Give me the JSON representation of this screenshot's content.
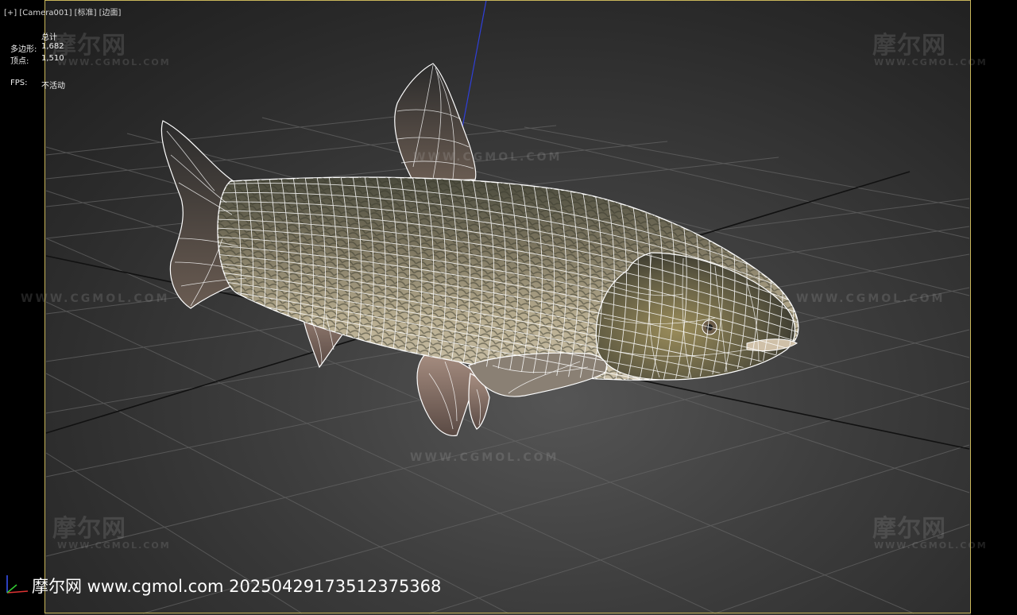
{
  "viewport": {
    "label": "[+] [Camera001] [标准] [边面]"
  },
  "stats": {
    "total_label": "总计",
    "polygons_label": "多边形:",
    "polygons_value": "1,682",
    "vertices_label": "顶点:",
    "vertices_value": "1,510",
    "fps_label": "FPS:",
    "fps_value": "不活动"
  },
  "watermark": {
    "logo": "摩尔网",
    "url_small": "WWW.CGMOL.COM",
    "url": "WWW.CGMOL.COM"
  },
  "footer": {
    "text": "摩尔网 www.cgmol.com 20250429173512375368"
  },
  "colors": {
    "frame": "#c9b65a",
    "grid": "#6a6a6a",
    "axis_dark": "#111111",
    "gizmo_z": "#2f3fd8",
    "wireframe": "#ffffff"
  }
}
